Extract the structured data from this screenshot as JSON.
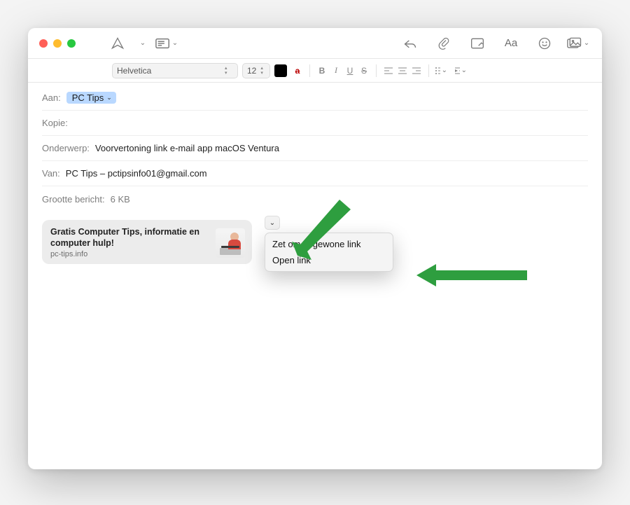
{
  "toolbar": {
    "send_icon": "send-icon",
    "header_icon": "header-fields-icon",
    "reply_icon": "reply-icon",
    "attach_icon": "attachment-icon",
    "markup_icon": "markup-icon",
    "format_label": "Aa",
    "emoji_icon": "emoji-icon",
    "media_icon": "media-browser-icon"
  },
  "formatbar": {
    "font": "Helvetica",
    "size": "12",
    "bold": "B",
    "italic": "I",
    "underline": "U",
    "strike": "S"
  },
  "fields": {
    "to_label": "Aan:",
    "to_chip": "PC Tips",
    "cc_label": "Kopie:",
    "subject_label": "Onderwerp:",
    "subject_value": "Voorvertoning link e-mail app macOS Ventura",
    "from_label": "Van:",
    "from_value": "PC Tips – pctipsinfo01@gmail.com",
    "size_label": "Grootte bericht:",
    "size_value": "6 KB"
  },
  "link_preview": {
    "title": "Gratis Computer Tips, informatie en computer hulp!",
    "domain": "pc-tips.info"
  },
  "dropdown_menu": {
    "item1": "Zet om in gewone link",
    "item2": "Open link"
  }
}
